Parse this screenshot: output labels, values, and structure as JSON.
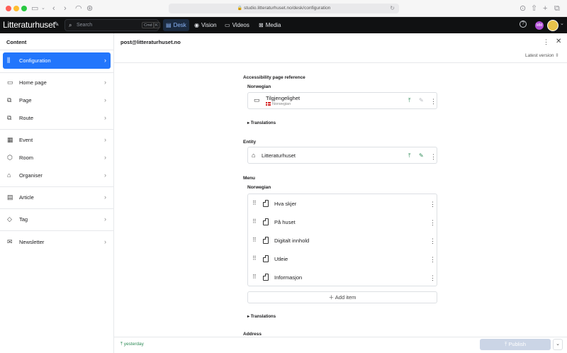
{
  "browser": {
    "url": "studio.litteraturhuset.no/desk/configuration"
  },
  "topnav": {
    "logo": "Litteraturhuset",
    "search_placeholder": "Search",
    "search_kbd_1": "Cmd",
    "search_kbd_2": "K",
    "tools": [
      {
        "label": "Desk",
        "icon": "desk-icon",
        "active": true
      },
      {
        "label": "Vision",
        "icon": "eye-icon",
        "active": false
      },
      {
        "label": "Videos",
        "icon": "video-icon",
        "active": false
      },
      {
        "label": "Media",
        "icon": "image-icon",
        "active": false
      }
    ],
    "avatar_initials": "MM"
  },
  "sidebar": {
    "title": "Content",
    "items": [
      {
        "label": "Configuration",
        "icon": "sliders-icon"
      },
      {
        "label": "Home page",
        "icon": "browser-icon"
      },
      {
        "label": "Page",
        "icon": "pages-icon"
      },
      {
        "label": "Route",
        "icon": "route-icon"
      },
      {
        "label": "Event",
        "icon": "calendar-icon"
      },
      {
        "label": "Room",
        "icon": "cube-icon"
      },
      {
        "label": "Organiser",
        "icon": "building-icon"
      },
      {
        "label": "Article",
        "icon": "article-icon"
      },
      {
        "label": "Tag",
        "icon": "tag-icon"
      },
      {
        "label": "Newsletter",
        "icon": "envelope-icon"
      }
    ]
  },
  "document": {
    "title": "post@litteraturhuset.no",
    "version": "Latest version",
    "accessibility": {
      "label": "Accessibility page reference",
      "lang_label": "Norwegian",
      "ref_title": "Tilgjengelighet",
      "ref_lang": "Norwegian",
      "translations": "Translations"
    },
    "entity": {
      "label": "Entity",
      "value": "Litteraturhuset"
    },
    "menu": {
      "label": "Menu",
      "lang_label": "Norwegian",
      "items": [
        "Hva skjer",
        "På huset",
        "Digitalt innhold",
        "Utleie",
        "Informasjon"
      ],
      "add_item": "Add item",
      "translations": "Translations"
    },
    "address_label": "Address"
  },
  "footer": {
    "status": "yesterday",
    "publish": "Publish"
  },
  "colors": {
    "accent": "#2276fc",
    "nav_bg": "#101112",
    "success": "#2e8b57",
    "publish_disabled": "#cbd5e6"
  }
}
